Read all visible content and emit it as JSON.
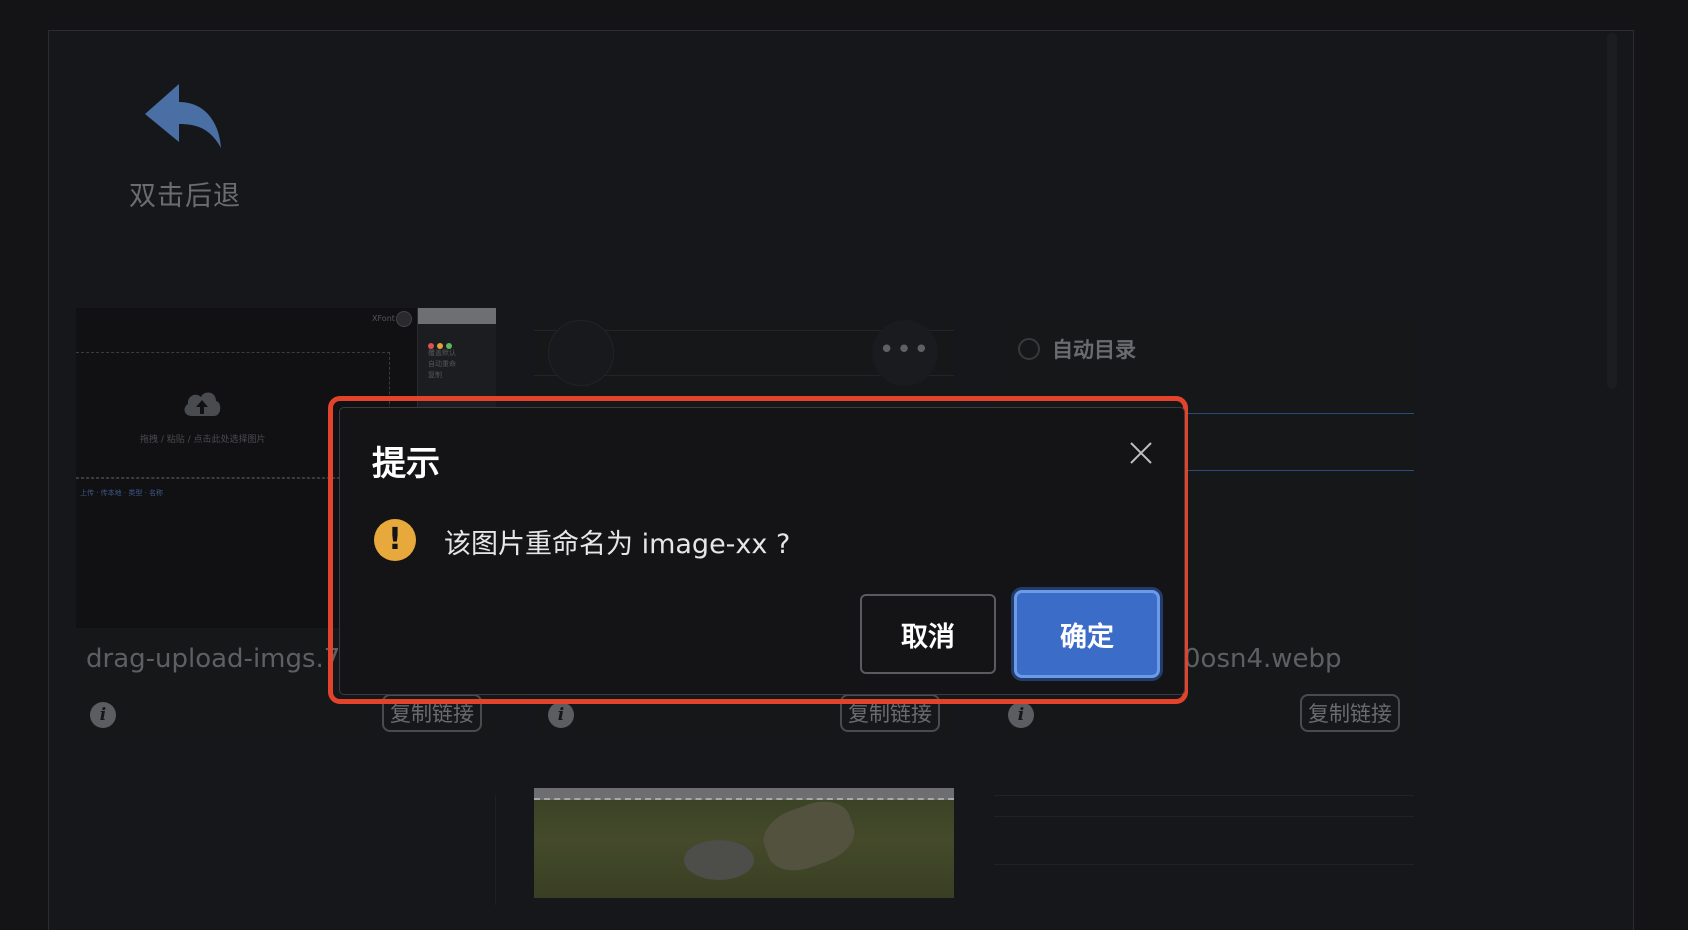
{
  "back": {
    "icon": "back-arrow-icon",
    "label": "双击后退"
  },
  "cards": [
    {
      "filename": "drag-upload-imgs.7",
      "copy_label": "复制链接",
      "thumb": {
        "header_text": "XFont",
        "drop_text": "拖拽 / 粘贴 / 点击此处选择图片",
        "menu": [
          "覆盖默认",
          "自动重命",
          "复制"
        ],
        "tags": "上传 · 传本地 · 类型 · 名称"
      }
    },
    {
      "filename": "",
      "copy_label": "复制链接",
      "more_label": "•••"
    },
    {
      "filename": "0osn4.webp",
      "copy_label": "复制链接",
      "option_label": "自动目录"
    }
  ],
  "dialog": {
    "title": "提示",
    "message": "该图片重命名为 image-xx ?",
    "cancel_label": "取消",
    "confirm_label": "确定"
  },
  "colors": {
    "accent": "#3a6cc8",
    "warning": "#e8a93c",
    "highlight": "#e2432a",
    "background": "#141417"
  }
}
